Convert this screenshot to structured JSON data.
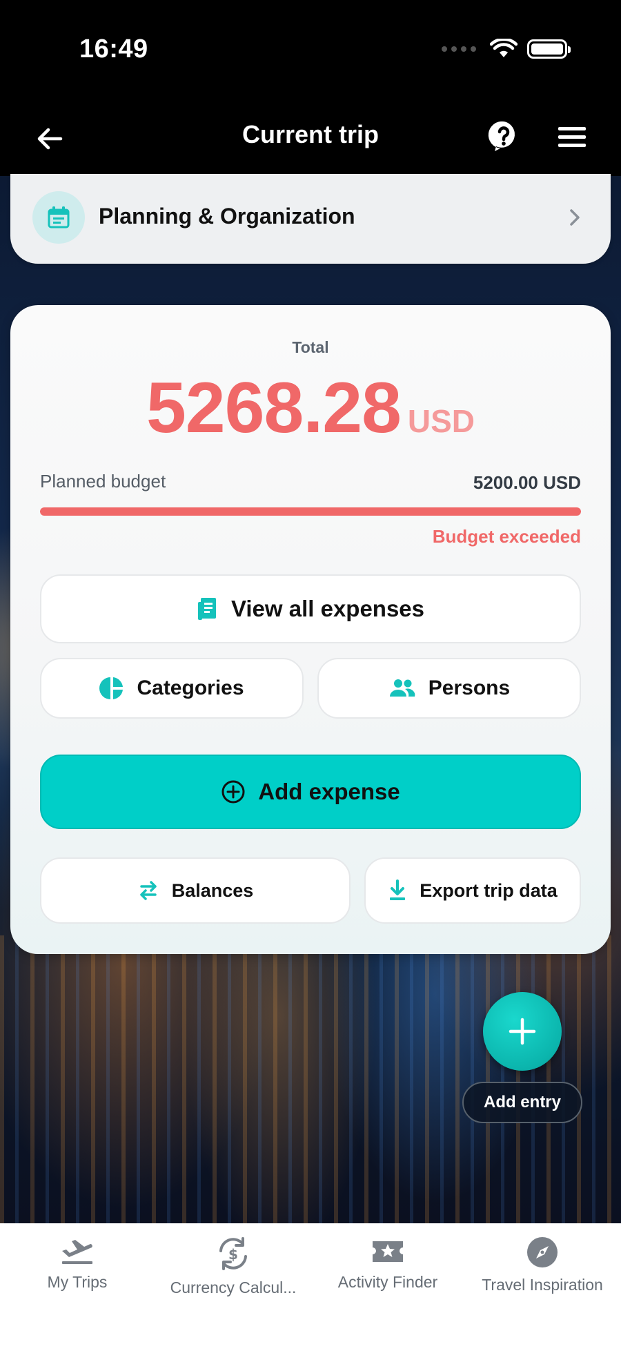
{
  "status_bar": {
    "time": "16:49"
  },
  "header": {
    "title": "Current trip"
  },
  "planning": {
    "label": "Planning & Organization"
  },
  "summary": {
    "total_label": "Total",
    "amount": "5268.28",
    "currency": "USD",
    "budget_label": "Planned budget",
    "budget_value": "5200.00 USD",
    "budget_progress_percent": 100,
    "budget_status": "Budget exceeded"
  },
  "actions": {
    "view_all": "View all expenses",
    "categories": "Categories",
    "persons": "Persons",
    "add_expense": "Add expense",
    "balances": "Balances",
    "export": "Export trip data"
  },
  "fab": {
    "label": "Add entry"
  },
  "bottom_nav": [
    {
      "label": "My Trips",
      "icon": "plane-departure-icon"
    },
    {
      "label": "Currency Calcul...",
      "icon": "currency-exchange-icon"
    },
    {
      "label": "Activity Finder",
      "icon": "ticket-star-icon"
    },
    {
      "label": "Travel Inspiration",
      "icon": "compass-icon"
    }
  ],
  "colors": {
    "accent": "#00cfc8",
    "danger": "#f06868"
  }
}
